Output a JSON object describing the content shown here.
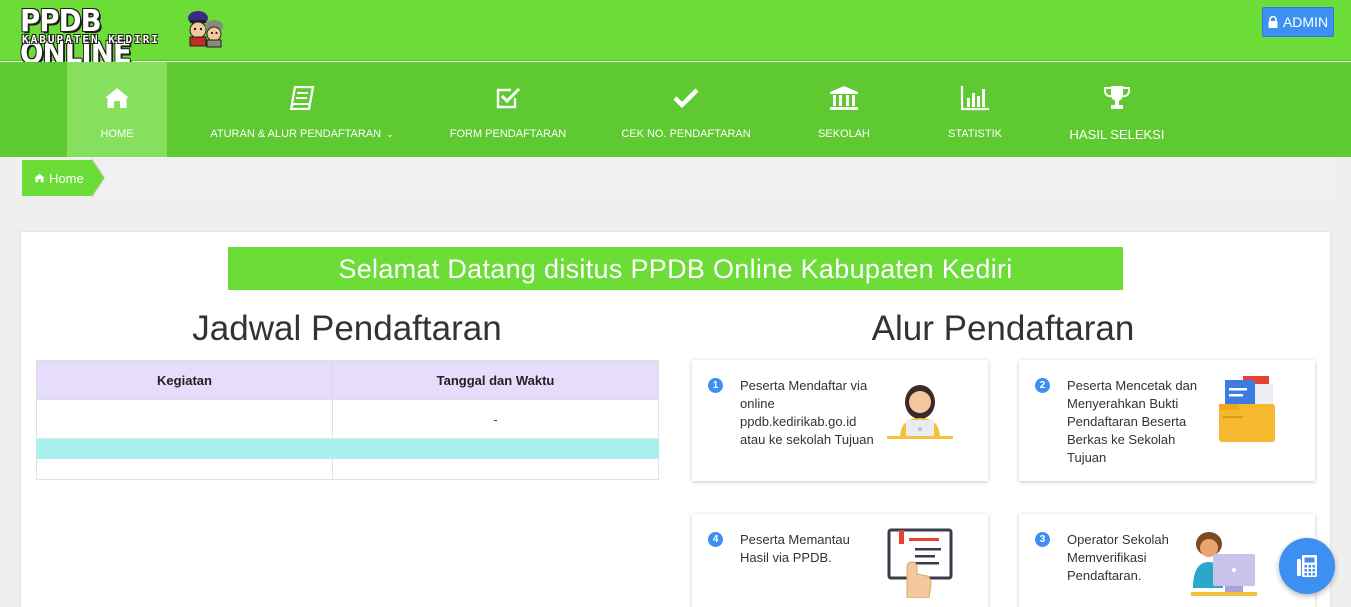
{
  "header": {
    "logo_title": "PPDB ONLINE",
    "logo_subtitle": "KABUPATEN KEDIRI",
    "admin_label": "ADMIN"
  },
  "nav": {
    "items": [
      {
        "label": "HOME",
        "icon": "home-icon",
        "active": true
      },
      {
        "label": "ATURAN & ALUR PENDAFTARAN",
        "icon": "book-icon",
        "dropdown": true
      },
      {
        "label": "FORM PENDAFTARAN",
        "icon": "check-square-icon"
      },
      {
        "label": "CEK NO. PENDAFTARAN",
        "icon": "check-icon"
      },
      {
        "label": "SEKOLAH",
        "icon": "bank-icon"
      },
      {
        "label": "STATISTIK",
        "icon": "bar-chart-icon"
      },
      {
        "label": "HASIL SELEKSI",
        "icon": "trophy-icon"
      }
    ]
  },
  "breadcrumb": {
    "home_label": "Home"
  },
  "main": {
    "welcome": "Selamat Datang disitus PPDB Online Kabupaten Kediri",
    "schedule_title": "Jadwal Pendaftaran",
    "flow_title": "Alur Pendaftaran",
    "table": {
      "headers": [
        "Kegiatan",
        "Tanggal dan Waktu"
      ],
      "rows": [
        [
          "",
          "-"
        ],
        [
          "",
          ""
        ],
        [
          "",
          ""
        ]
      ]
    },
    "steps": [
      {
        "num": "1",
        "text": "Peserta Mendaftar via online ppdb.kedirikab.go.id atau ke sekolah Tujuan",
        "icon": "person-laptop-icon"
      },
      {
        "num": "2",
        "text": "Peserta Mencetak dan Menyerahkan Bukti Pendaftaran Beserta Berkas ke Sekolah Tujuan",
        "icon": "folder-documents-icon"
      },
      {
        "num": "4",
        "text": "Peserta Memantau Hasil via PPDB.",
        "icon": "touch-screen-icon"
      },
      {
        "num": "3",
        "text": "Operator Sekolah Memverifikasi Pendaftaran.",
        "icon": "operator-computer-icon"
      }
    ]
  },
  "colors": {
    "brand_green": "#6cdc37",
    "nav_green": "#5ec931",
    "accent_blue": "#3d8ff2",
    "table_header": "#e6dcfb",
    "table_highlight": "#a9f1ee"
  }
}
